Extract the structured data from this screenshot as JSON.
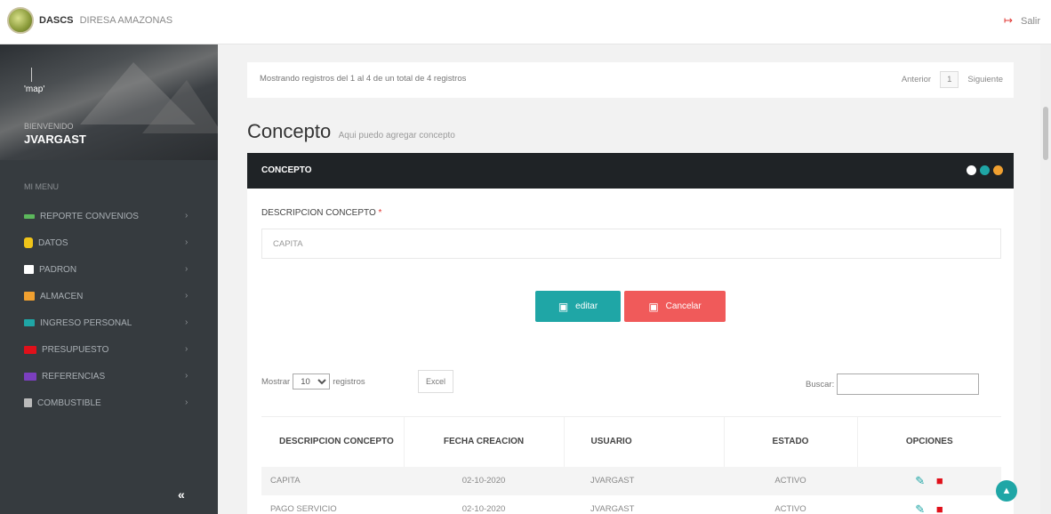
{
  "header": {
    "brand": "DASCS",
    "org": "DIRESA AMAZONAS",
    "logout_label": "Salir",
    "logout_icon": "sign-out-icon"
  },
  "sidebar": {
    "avatar_alt": "'map'",
    "welcome": "BIENVENIDO",
    "username": "JVARGAST",
    "menu_title": "MI MENU",
    "items": [
      {
        "label": "REPORTE CONVENIOS",
        "icon": "check-icon",
        "color": "#5cb85c"
      },
      {
        "label": "DATOS",
        "icon": "database-icon",
        "color": "#f0c419"
      },
      {
        "label": "PADRON",
        "icon": "table-icon",
        "color": "#ffffff"
      },
      {
        "label": "ALMACEN",
        "icon": "cubes-icon",
        "color": "#f0a030"
      },
      {
        "label": "INGRESO PERSONAL",
        "icon": "user-plus-icon",
        "color": "#1fa6a6"
      },
      {
        "label": "PRESUPUESTO",
        "icon": "money-icon",
        "color": "#e0101a"
      },
      {
        "label": "REFERENCIAS",
        "icon": "list-icon",
        "color": "#7b3fbf"
      },
      {
        "label": "COMBUSTIBLE",
        "icon": "gas-icon",
        "color": "#bbbbbb"
      }
    ],
    "collapse_label": "«"
  },
  "records": {
    "text": "Mostrando registros del 1 al 4 de un total de 4 registros",
    "prev": "Anterior",
    "page": "1",
    "next": "Siguiente"
  },
  "page": {
    "title": "Concepto",
    "subtitle": "Aqui puedo agregar concepto"
  },
  "card": {
    "title": "CONCEPTO",
    "dot_colors": [
      "#ffffff",
      "#1fa6a6",
      "#f0a030"
    ]
  },
  "form": {
    "label": "DESCRIPCION CONCEPTO",
    "required_mark": "*",
    "value": "CAPITA",
    "edit_label": "editar",
    "cancel_label": "Cancelar"
  },
  "table_controls": {
    "show_prefix": "Mostrar",
    "show_value": "10",
    "show_suffix": "registros",
    "excel_label": "Excel",
    "search_label": "Buscar:"
  },
  "table": {
    "headers": [
      "DESCRIPCION CONCEPTO",
      "FECHA CREACION",
      "USUARIO",
      "ESTADO",
      "OPCIONES"
    ],
    "rows": [
      {
        "descripcion": "CAPITA",
        "fecha": "02-10-2020",
        "usuario": "JVARGAST",
        "estado": "ACTIVO"
      },
      {
        "descripcion": "PAGO SERVICIO",
        "fecha": "02-10-2020",
        "usuario": "JVARGAST",
        "estado": "ACTIVO"
      }
    ]
  }
}
